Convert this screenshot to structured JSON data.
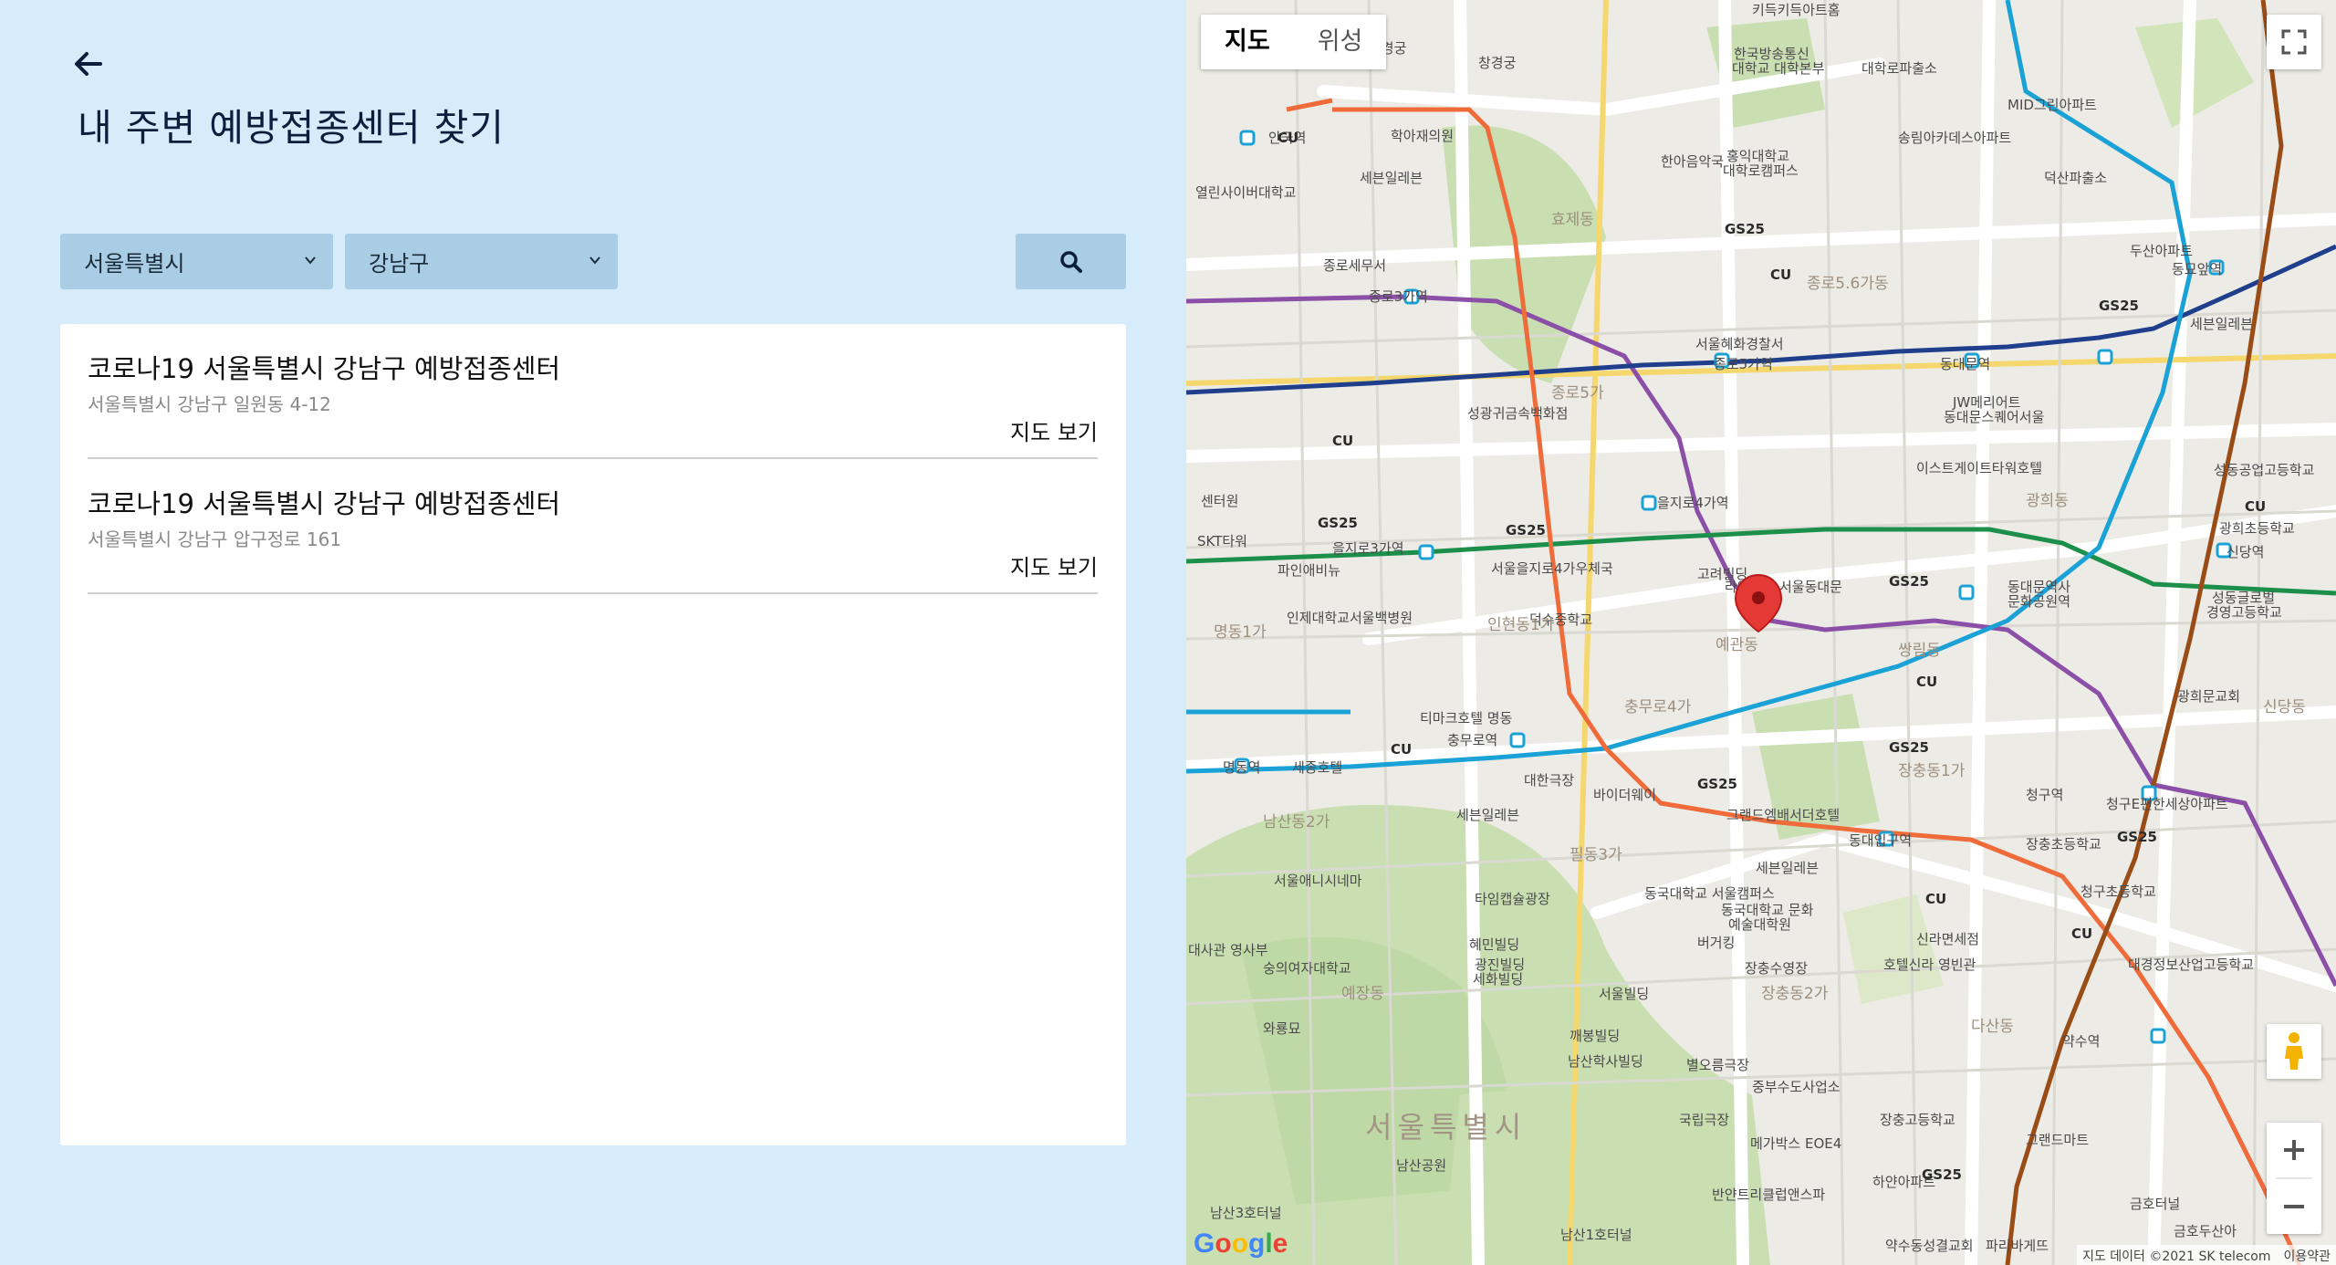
{
  "page": {
    "title": "내 주변 예방접종센터 찾기"
  },
  "filters": {
    "city": "서울특별시",
    "district": "강남구"
  },
  "results": [
    {
      "name": "코로나19 서울특별시 강남구 예방접종센터",
      "address": "서울특별시 강남구 일원동 4-12",
      "link": "지도 보기"
    },
    {
      "name": "코로나19 서울특별시 강남구 예방접종센터",
      "address": "서울특별시 강남구 압구정로 161",
      "link": "지도 보기"
    }
  ],
  "map": {
    "type_buttons": [
      "지도",
      "위성"
    ],
    "active_type": "지도",
    "attribution": "지도 데이터 ©2021 SK telecom",
    "terms": "이용약관",
    "logo": "Google",
    "city_label": "서울특별시",
    "labels": [
      "한국방송통신대학교 대학본부",
      "창경궁",
      "MID그린아파트",
      "학아재의원",
      "한아음악국",
      "홍익대학교 대학로캠퍼스",
      "세븐일레븐",
      "종로세무서",
      "종로3가역",
      "종로5가역",
      "동대문역",
      "서울혜화경찰서",
      "성광귀금속백화점",
      "을지로4가역",
      "을지로3가역",
      "서울을지로4가우체국",
      "이스트게이트타워호텔",
      "동대문역사문화공원역",
      "덕수중학교",
      "인제대학교서울백병원",
      "신당역",
      "광희초등학교",
      "티마크호텔 명동",
      "충무로역",
      "명동역",
      "세종호텔",
      "대한극장",
      "바이더웨이",
      "그랜드엠배서더호텔",
      "동대입구역",
      "청구역",
      "장충초등학교",
      "서울애니시네마",
      "동국대학교 서울캠퍼스",
      "타임캡슐광장",
      "혜민빌딩",
      "숭의여자대학교",
      "와룡묘",
      "장충수영장",
      "호텔신라 영빈관",
      "약수역",
      "별오름극장",
      "남산학사빌딩",
      "국립극장",
      "메가박스 EOE4",
      "장충고등학교",
      "반얀트리클럽앤스파",
      "남산공원",
      "남산3호터널",
      "남산1호터널",
      "약수동성결교회",
      "금호터널",
      "안국역",
      "세븐일레븐",
      "두산아파트",
      "동묘앞역",
      "GS25",
      "CU",
      "신라면세점",
      "그랜드마트",
      "대경정보산업고등학교",
      "청구초등학교",
      "파인애비뉴",
      "SKT타워"
    ]
  }
}
